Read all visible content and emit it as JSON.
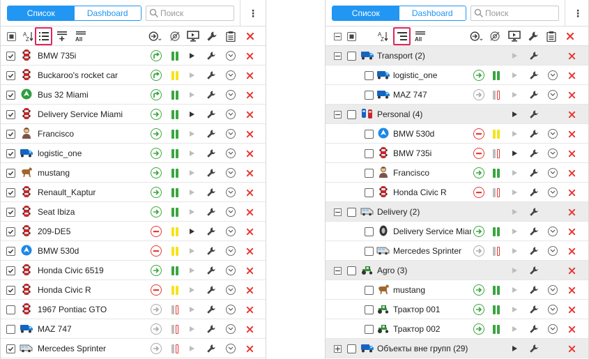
{
  "tabs": {
    "list": "Список",
    "dashboard": "Dashboard"
  },
  "search": {
    "placeholder": "Поиск"
  },
  "menu_glyph": "⋮",
  "colors": {
    "accent": "#2196f3",
    "highlight": "#e0245e",
    "group_bg": "#ececec",
    "status_green": "#3aa63f",
    "status_red": "#e53935",
    "status_gray": "#aaaaaa",
    "signal_yellow": "#f5e31c",
    "signal_gray": "#bdbdbd"
  },
  "toolbar_icons": {
    "left": [
      "select-all-checkbox-icon",
      "sort-az-icon",
      "list-view-icon",
      "add-to-list-icon",
      "show-all-icon",
      "commands-icon",
      "location-icon",
      "monitor-icon",
      "settings-wrench-icon",
      "clipboard-icon",
      "delete-icon"
    ],
    "right": [
      "collapse-icon",
      "select-all-checkbox-icon",
      "sort-az-icon",
      "group-view-icon",
      "show-all-icon",
      "commands-icon",
      "location-icon",
      "monitor-icon",
      "settings-wrench-icon",
      "clipboard-icon",
      "delete-icon"
    ]
  },
  "left_list": {
    "units": [
      {
        "name": "BMW 735i",
        "checked": true,
        "icon": "car-icon",
        "motion": "green-curved",
        "signal": "green",
        "play": "dark",
        "driver": true
      },
      {
        "name": "Buckaroo's rocket car",
        "checked": true,
        "icon": "car-icon",
        "motion": "green-curved",
        "signal": "yellow",
        "play": "light",
        "driver": true
      },
      {
        "name": "Bus 32 Miami",
        "checked": true,
        "icon": "green-arrow-icon",
        "motion": "green-curved",
        "signal": "green",
        "play": "light",
        "driver": true
      },
      {
        "name": "Delivery Service Miami",
        "checked": true,
        "icon": "car-icon",
        "motion": "green",
        "signal": "green",
        "play": "dark",
        "driver": true
      },
      {
        "name": "Francisco",
        "checked": true,
        "icon": "person-icon",
        "motion": "green",
        "signal": "green",
        "play": "light",
        "driver": true
      },
      {
        "name": "logistic_one",
        "checked": true,
        "icon": "truck-icon",
        "motion": "green",
        "signal": "green",
        "play": "light",
        "driver": true
      },
      {
        "name": "mustang",
        "checked": true,
        "icon": "horse-icon",
        "motion": "green",
        "signal": "green",
        "play": "light",
        "driver": true
      },
      {
        "name": "Renault_Kaptur",
        "checked": true,
        "icon": "car-icon",
        "motion": "green",
        "signal": "green",
        "play": "light",
        "driver": true
      },
      {
        "name": "Seat Ibiza",
        "checked": true,
        "icon": "car-icon",
        "motion": "green",
        "signal": "green",
        "play": "light",
        "driver": true
      },
      {
        "name": "209-DE5",
        "checked": true,
        "icon": "car-icon",
        "motion": "red",
        "signal": "yellow",
        "play": "dark",
        "driver": true
      },
      {
        "name": "BMW 530d",
        "checked": true,
        "icon": "blue-arrow-icon",
        "motion": "red",
        "signal": "yellow",
        "play": "light",
        "driver": true
      },
      {
        "name": "Honda Civic 6519",
        "checked": true,
        "icon": "car-icon",
        "motion": "green",
        "signal": "green",
        "play": "light",
        "driver": true
      },
      {
        "name": "Honda Civic R",
        "checked": true,
        "icon": "car-icon",
        "motion": "red",
        "signal": "yellow",
        "play": "light",
        "driver": true
      },
      {
        "name": "1967 Pontiac GTO",
        "checked": false,
        "icon": "car-icon",
        "motion": "gray",
        "signal": "gray",
        "play": "light",
        "driver": true
      },
      {
        "name": "MAZ 747",
        "checked": false,
        "icon": "truck-icon",
        "motion": "gray",
        "signal": "gray",
        "play": "light",
        "driver": true
      },
      {
        "name": "Mercedes Sprinter",
        "checked": true,
        "icon": "van-icon",
        "motion": "gray",
        "signal": "gray",
        "play": "light",
        "driver": true
      }
    ]
  },
  "right_list": {
    "rows": [
      {
        "kind": "group",
        "name": "Transport (2)",
        "icon": "truck-icon",
        "expand": "minus",
        "play": "light"
      },
      {
        "kind": "unit",
        "name": "logistic_one",
        "icon": "truck-icon",
        "motion": "green",
        "signal": "green",
        "play": "light",
        "driver": true
      },
      {
        "kind": "unit",
        "name": "MAZ 747",
        "icon": "truck-icon",
        "motion": "gray",
        "signal": "gray",
        "play": "light",
        "driver": true
      },
      {
        "kind": "group",
        "name": "Personal (4)",
        "icon": "cars-icon",
        "expand": "minus",
        "play": "dark"
      },
      {
        "kind": "unit",
        "name": "BMW 530d",
        "icon": "blue-arrow-icon",
        "motion": "red",
        "signal": "yellow",
        "play": "light",
        "driver": true
      },
      {
        "kind": "unit",
        "name": "BMW 735i",
        "icon": "car-icon",
        "motion": "red",
        "signal": "gray-red",
        "play": "dark",
        "driver": true
      },
      {
        "kind": "unit",
        "name": "Francisco",
        "icon": "person-icon",
        "motion": "green",
        "signal": "green",
        "play": "light",
        "driver": true
      },
      {
        "kind": "unit",
        "name": "Honda Civic R",
        "icon": "car-icon",
        "motion": "red",
        "signal": "gray-red",
        "play": "light",
        "driver": true
      },
      {
        "kind": "group",
        "name": "Delivery (2)",
        "icon": "van-icon",
        "expand": "minus",
        "play": "light"
      },
      {
        "kind": "unit",
        "name": "Delivery Service Miami",
        "icon": "tire-icon",
        "motion": "green",
        "signal": "green",
        "play": "light",
        "driver": true
      },
      {
        "kind": "unit",
        "name": "Mercedes Sprinter",
        "icon": "van-icon",
        "motion": "gray",
        "signal": "gray",
        "play": "light",
        "driver": true
      },
      {
        "kind": "group",
        "name": "Agro (3)",
        "icon": "tractor-icon",
        "expand": "minus",
        "play": "light"
      },
      {
        "kind": "unit",
        "name": "mustang",
        "icon": "horse-icon",
        "motion": "green",
        "signal": "green",
        "play": "light",
        "driver": true
      },
      {
        "kind": "unit",
        "name": "Трактор 001",
        "icon": "tractor-icon",
        "motion": "green",
        "signal": "green",
        "play": "light",
        "driver": true
      },
      {
        "kind": "unit",
        "name": "Трактор 002",
        "icon": "tractor-icon",
        "motion": "green",
        "signal": "green",
        "play": "light",
        "driver": true
      },
      {
        "kind": "group",
        "name": "Объекты вне групп (29)",
        "icon": "truck-icon",
        "expand": "plus",
        "play": "dark"
      }
    ]
  }
}
